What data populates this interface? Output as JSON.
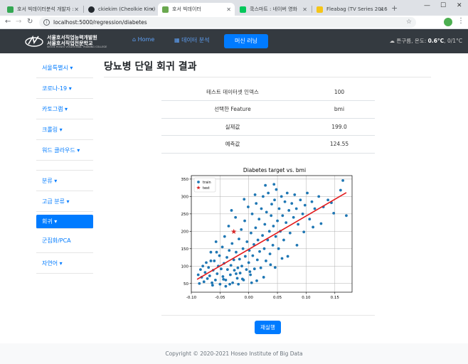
{
  "browser": {
    "tabs": [
      {
        "label": "호서 빅데이터분석 개발자 :",
        "color": "#34a853"
      },
      {
        "label": "ckiekim (Cheolkie Kim)",
        "color": "#24292e"
      },
      {
        "label": "호서 빅데이터",
        "color": "#6aa84f"
      },
      {
        "label": "쿡스마트 : 네이버 영화",
        "color": "#03c75a"
      },
      {
        "label": "Fleabag (TV Series 2016–20",
        "color": "#f5c518"
      }
    ],
    "url": "localhost:5000/regression/diabetes"
  },
  "navbar": {
    "logo_line1": "서울호서직업능력개발원",
    "logo_line2": "서울호서직업전문학교",
    "logo_line3": "SEOUL HOSEO VOCATIONAL TRAINING COLLEGE",
    "home": "Home",
    "data_analysis": "데이터 분석",
    "machine_learning": "머신 러닝",
    "weather_prefix": "튼구름, 온도: ",
    "weather_temp": "0.6°C",
    "weather_suffix": ", 0/1°C"
  },
  "sidebar": {
    "items": [
      "서울특별시",
      "코로나-19",
      "카토그램",
      "크롤링",
      "워드 클라우드",
      "분류",
      "고급 분류",
      "회귀",
      "군집화/PCA",
      "자연어"
    ]
  },
  "main": {
    "title": "당뇨병 단일 회귀 결과",
    "rows": [
      {
        "key": "테스트 데이터셋 인덱스",
        "value": "100"
      },
      {
        "key": "선택한 Feature",
        "value": "bmi"
      },
      {
        "key": "실제값",
        "value": "199.0"
      },
      {
        "key": "예측값",
        "value": "124.55"
      }
    ],
    "rerun": "재실행"
  },
  "footer": "Copyright © 2020-2021 Hoseo Institute of Big Data",
  "chart_data": {
    "type": "scatter",
    "title": "Diabetes target vs. bmi",
    "xlabel": "",
    "ylabel": "",
    "xlim": [
      -0.1,
      0.18
    ],
    "ylim": [
      25,
      360
    ],
    "xticks": [
      -0.1,
      -0.05,
      0.0,
      0.05,
      0.1,
      0.15
    ],
    "yticks": [
      50,
      100,
      150,
      200,
      250,
      300,
      350
    ],
    "grid": true,
    "legend_position": "top-left",
    "series": [
      {
        "name": "train",
        "kind": "points",
        "color": "#1f77b4",
        "points": [
          [
            -0.088,
            75
          ],
          [
            -0.084,
            90
          ],
          [
            -0.082,
            68
          ],
          [
            -0.08,
            100
          ],
          [
            -0.078,
            55
          ],
          [
            -0.076,
            82
          ],
          [
            -0.074,
            110
          ],
          [
            -0.072,
            64
          ],
          [
            -0.07,
            96
          ],
          [
            -0.068,
            72
          ],
          [
            -0.066,
            140
          ],
          [
            -0.064,
            52
          ],
          [
            -0.062,
            88
          ],
          [
            -0.06,
            115
          ],
          [
            -0.058,
            60
          ],
          [
            -0.057,
            170
          ],
          [
            -0.055,
            78
          ],
          [
            -0.053,
            100
          ],
          [
            -0.051,
            130
          ],
          [
            -0.05,
            48
          ],
          [
            -0.048,
            92
          ],
          [
            -0.046,
            155
          ],
          [
            -0.045,
            70
          ],
          [
            -0.043,
            108
          ],
          [
            -0.042,
            185
          ],
          [
            -0.04,
            60
          ],
          [
            -0.038,
            125
          ],
          [
            -0.037,
            90
          ],
          [
            -0.035,
            215
          ],
          [
            -0.034,
            145
          ],
          [
            -0.032,
            75
          ],
          [
            -0.031,
            102
          ],
          [
            -0.029,
            165
          ],
          [
            -0.028,
            52
          ],
          [
            -0.026,
            118
          ],
          [
            -0.025,
            88
          ],
          [
            -0.023,
            240
          ],
          [
            -0.022,
            140
          ],
          [
            -0.02,
            65
          ],
          [
            -0.019,
            95
          ],
          [
            -0.017,
            178
          ],
          [
            -0.016,
            120
          ],
          [
            -0.015,
            80
          ],
          [
            -0.013,
            205
          ],
          [
            -0.012,
            100
          ],
          [
            -0.01,
            150
          ],
          [
            -0.009,
            60
          ],
          [
            -0.007,
            230
          ],
          [
            -0.006,
            128
          ],
          [
            -0.004,
            90
          ],
          [
            -0.003,
            170
          ],
          [
            -0.001,
            270
          ],
          [
            0.0,
            110
          ],
          [
            0.001,
            145
          ],
          [
            0.003,
            75
          ],
          [
            0.004,
            195
          ],
          [
            0.006,
            250
          ],
          [
            0.007,
            130
          ],
          [
            0.009,
            162
          ],
          [
            0.01,
            92
          ],
          [
            0.012,
            210
          ],
          [
            0.013,
            280
          ],
          [
            0.015,
            118
          ],
          [
            0.016,
            175
          ],
          [
            0.018,
            235
          ],
          [
            0.019,
            142
          ],
          [
            0.021,
            95
          ],
          [
            0.022,
            265
          ],
          [
            0.024,
            188
          ],
          [
            0.025,
            300
          ],
          [
            0.027,
            150
          ],
          [
            0.028,
            220
          ],
          [
            0.03,
            115
          ],
          [
            0.031,
            255
          ],
          [
            0.033,
            175
          ],
          [
            0.034,
            310
          ],
          [
            0.036,
            200
          ],
          [
            0.037,
            135
          ],
          [
            0.039,
            245
          ],
          [
            0.04,
            278
          ],
          [
            0.042,
            160
          ],
          [
            0.043,
            215
          ],
          [
            0.045,
            290
          ],
          [
            0.047,
            185
          ],
          [
            0.048,
            320
          ],
          [
            0.05,
            230
          ],
          [
            0.052,
            150
          ],
          [
            0.053,
            265
          ],
          [
            0.055,
            200
          ],
          [
            0.057,
            300
          ],
          [
            0.059,
            245
          ],
          [
            0.061,
            175
          ],
          [
            0.063,
            285
          ],
          [
            0.065,
            225
          ],
          [
            0.067,
            310
          ],
          [
            0.07,
            260
          ],
          [
            0.072,
            195
          ],
          [
            0.075,
            280
          ],
          [
            0.078,
            240
          ],
          [
            0.08,
            305
          ],
          [
            0.083,
            265
          ],
          [
            0.086,
            220
          ],
          [
            0.09,
            290
          ],
          [
            0.094,
            250
          ],
          [
            0.098,
            275
          ],
          [
            0.102,
            310
          ],
          [
            0.106,
            235
          ],
          [
            0.11,
            285
          ],
          [
            0.115,
            265
          ],
          [
            0.122,
            300
          ],
          [
            0.13,
            270
          ],
          [
            0.138,
            290
          ],
          [
            0.148,
            252
          ],
          [
            0.16,
            318
          ],
          [
            0.17,
            245
          ],
          [
            -0.086,
            50
          ],
          [
            -0.063,
            45
          ],
          [
            -0.04,
            42
          ],
          [
            -0.018,
            48
          ],
          [
            0.005,
            52
          ],
          [
            -0.066,
            115
          ],
          [
            -0.056,
            140
          ],
          [
            -0.044,
            62
          ],
          [
            -0.033,
            48
          ],
          [
            -0.022,
            78
          ],
          [
            -0.011,
            63
          ],
          [
            0.002,
            84
          ],
          [
            0.014,
            58
          ],
          [
            0.026,
            68
          ],
          [
            0.038,
            104
          ],
          [
            0.046,
            96
          ],
          [
            0.058,
            122
          ],
          [
            0.068,
            128
          ],
          [
            0.084,
            160
          ],
          [
            0.096,
            198
          ],
          [
            0.112,
            212
          ],
          [
            0.126,
            222
          ],
          [
            0.144,
            282
          ],
          [
            0.164,
            346
          ],
          [
            -0.03,
            260
          ],
          [
            -0.008,
            292
          ],
          [
            0.011,
            305
          ],
          [
            0.029,
            332
          ],
          [
            0.044,
            335
          ]
        ]
      },
      {
        "name": "test",
        "kind": "star",
        "color": "#d62728",
        "points": [
          [
            -0.026,
            199
          ]
        ]
      },
      {
        "name": "fit",
        "kind": "line",
        "color": "#e31a1c",
        "points": [
          [
            -0.09,
            62
          ],
          [
            0.17,
            311
          ]
        ]
      }
    ]
  }
}
